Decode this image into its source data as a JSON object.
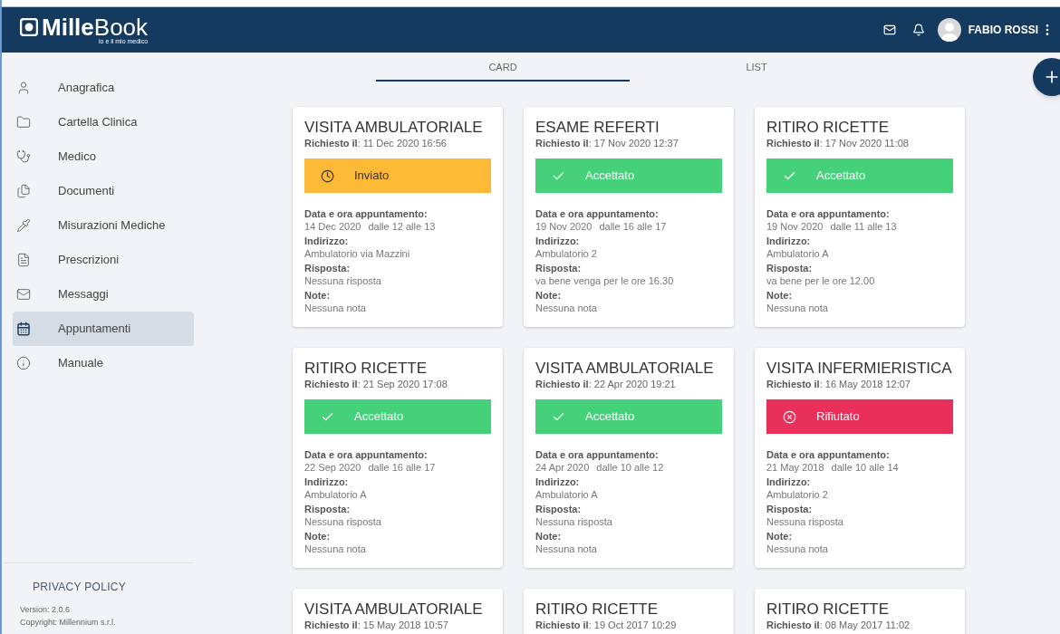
{
  "header": {
    "logo_bold": "Mille",
    "logo_light": "Book",
    "tagline": "io e il mio medico",
    "user_name": "FABIO ROSSI"
  },
  "sidebar": {
    "items": [
      {
        "label": "Anagrafica",
        "selected": false
      },
      {
        "label": "Cartella Clinica",
        "selected": false
      },
      {
        "label": "Medico",
        "selected": false
      },
      {
        "label": "Documenti",
        "selected": false
      },
      {
        "label": "Misurazioni Mediche",
        "selected": false
      },
      {
        "label": "Prescrizioni",
        "selected": false
      },
      {
        "label": "Messaggi",
        "selected": false
      },
      {
        "label": "Appuntamenti",
        "selected": true
      },
      {
        "label": "Manuale",
        "selected": false
      }
    ],
    "privacy": "PRIVACY POLICY",
    "version": "Version: 2.0.6",
    "copyright": "Copyright: Millennium s.r.l."
  },
  "tabs": [
    {
      "label": "CARD",
      "selected": true
    },
    {
      "label": "LIST",
      "selected": false
    }
  ],
  "cards": [
    {
      "title": "VISITA AMBULATORIALE",
      "requested_label": "Richiesto il",
      "requested": ": 11 Dec 2020 16:56",
      "status": {
        "kind": "sent",
        "label": "Inviato"
      },
      "fields": [
        {
          "label": "Data e ora appuntamento:",
          "value": "14 Dec 2020",
          "extra": "dalle 12 alle 13"
        },
        {
          "label": "Indirizzo:",
          "value": "Ambulatorio via Mazzini"
        },
        {
          "label": "Risposta:",
          "value": "Nessuna risposta"
        },
        {
          "label": "Note:",
          "value": "Nessuna nota"
        }
      ]
    },
    {
      "title": "ESAME REFERTI",
      "requested_label": "Richiesto il",
      "requested": ": 17 Nov 2020 12:37",
      "status": {
        "kind": "accepted",
        "label": "Accettato"
      },
      "fields": [
        {
          "label": "Data e ora appuntamento:",
          "value": "19 Nov 2020",
          "extra": "dalle 16 alle 17"
        },
        {
          "label": "Indirizzo:",
          "value": "Ambulatorio 2"
        },
        {
          "label": "Risposta:",
          "value": "va bene venga per le ore 16.30"
        },
        {
          "label": "Note:",
          "value": "Nessuna nota"
        }
      ]
    },
    {
      "title": "RITIRO RICETTE",
      "requested_label": "Richiesto il",
      "requested": ": 17 Nov 2020 11:08",
      "status": {
        "kind": "accepted",
        "label": "Accettato"
      },
      "fields": [
        {
          "label": "Data e ora appuntamento:",
          "value": "19 Nov 2020",
          "extra": "dalle 11 alle 13"
        },
        {
          "label": "Indirizzo:",
          "value": "Ambulatorio A"
        },
        {
          "label": "Risposta:",
          "value": "va bene per le ore 12.00"
        },
        {
          "label": "Note:",
          "value": "Nessuna nota"
        }
      ]
    },
    {
      "title": "RITIRO RICETTE",
      "requested_label": "Richiesto il",
      "requested": ": 21 Sep 2020 17:08",
      "status": {
        "kind": "accepted",
        "label": "Accettato"
      },
      "fields": [
        {
          "label": "Data e ora appuntamento:",
          "value": "22 Sep 2020",
          "extra": "dalle 16 alle 17"
        },
        {
          "label": "Indirizzo:",
          "value": "Ambulatorio A"
        },
        {
          "label": "Risposta:",
          "value": "Nessuna risposta"
        },
        {
          "label": "Note:",
          "value": "Nessuna nota"
        }
      ]
    },
    {
      "title": "VISITA AMBULATORIALE",
      "requested_label": "Richiesto il",
      "requested": ": 22 Apr 2020 19:21",
      "status": {
        "kind": "accepted",
        "label": "Accettato"
      },
      "fields": [
        {
          "label": "Data e ora appuntamento:",
          "value": "24 Apr 2020",
          "extra": "dalle 10 alle 12"
        },
        {
          "label": "Indirizzo:",
          "value": "Ambulatorio A"
        },
        {
          "label": "Risposta:",
          "value": "Nessuna risposta"
        },
        {
          "label": "Note:",
          "value": "Nessuna nota"
        }
      ]
    },
    {
      "title": "VISITA INFERMIERISTICA",
      "requested_label": "Richiesto il",
      "requested": ": 16 May 2018 12:07",
      "status": {
        "kind": "rejected",
        "label": "Rifiutato"
      },
      "fields": [
        {
          "label": "Data e ora appuntamento:",
          "value": "21 May 2018",
          "extra": "dalle 10 alle 14"
        },
        {
          "label": "Indirizzo:",
          "value": "Ambulatorio 2"
        },
        {
          "label": "Risposta:",
          "value": "Nessuna risposta"
        },
        {
          "label": "Note:",
          "value": "Nessuna nota"
        }
      ]
    },
    {
      "title": "VISITA AMBULATORIALE",
      "requested_label": "Richiesto il",
      "requested": ": 15 May 2018 10:57"
    },
    {
      "title": "RITIRO RICETTE",
      "requested_label": "Richiesto il",
      "requested": ": 19 Oct 2017 10:29"
    },
    {
      "title": "RITIRO RICETTE",
      "requested_label": "Richiesto il",
      "requested": ": 08 May 2017 11:02"
    }
  ]
}
